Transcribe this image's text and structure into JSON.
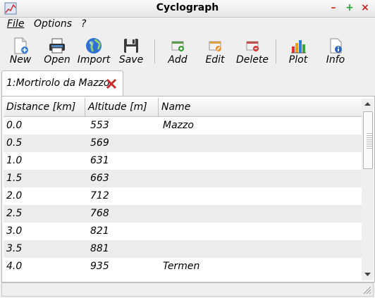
{
  "window": {
    "title": "Cyclograph",
    "controls": [
      "–",
      "+",
      "×"
    ]
  },
  "menubar": [
    {
      "label": "File",
      "mnemonic": "F",
      "rest": "ile"
    },
    {
      "label": "Options",
      "mnemonic": "O",
      "rest": "ptions"
    },
    {
      "label": "?",
      "mnemonic": "",
      "rest": "?"
    }
  ],
  "toolbar": [
    {
      "label": "New",
      "icon": "new-file-icon"
    },
    {
      "label": "Open",
      "icon": "printer-icon"
    },
    {
      "label": "Import",
      "icon": "globe-icon"
    },
    {
      "label": "Save",
      "icon": "floppy-disk-icon"
    },
    {
      "label": "Add",
      "icon": "add-row-icon"
    },
    {
      "label": "Edit",
      "icon": "edit-row-icon"
    },
    {
      "label": "Delete",
      "icon": "delete-row-icon"
    },
    {
      "label": "Plot",
      "icon": "bar-chart-icon"
    },
    {
      "label": "Info",
      "icon": "info-icon"
    }
  ],
  "tab": {
    "label": "1:Mortirolo da Mazzo",
    "close_color": "#cc2222"
  },
  "table": {
    "columns": [
      "Distance [km]",
      "Altitude [m]",
      "Name"
    ],
    "rows": [
      {
        "distance": "0.0",
        "altitude": "553",
        "name": "Mazzo"
      },
      {
        "distance": "0.5",
        "altitude": "569",
        "name": ""
      },
      {
        "distance": "1.0",
        "altitude": "631",
        "name": ""
      },
      {
        "distance": "1.5",
        "altitude": "663",
        "name": ""
      },
      {
        "distance": "2.0",
        "altitude": "712",
        "name": ""
      },
      {
        "distance": "2.5",
        "altitude": "768",
        "name": ""
      },
      {
        "distance": "3.0",
        "altitude": "821",
        "name": ""
      },
      {
        "distance": "3.5",
        "altitude": "881",
        "name": ""
      },
      {
        "distance": "4.0",
        "altitude": "935",
        "name": "Termen"
      }
    ]
  },
  "colors": {
    "close_red": "#cc2222",
    "minimize": "#c0392b",
    "maximize": "#27a22f"
  }
}
